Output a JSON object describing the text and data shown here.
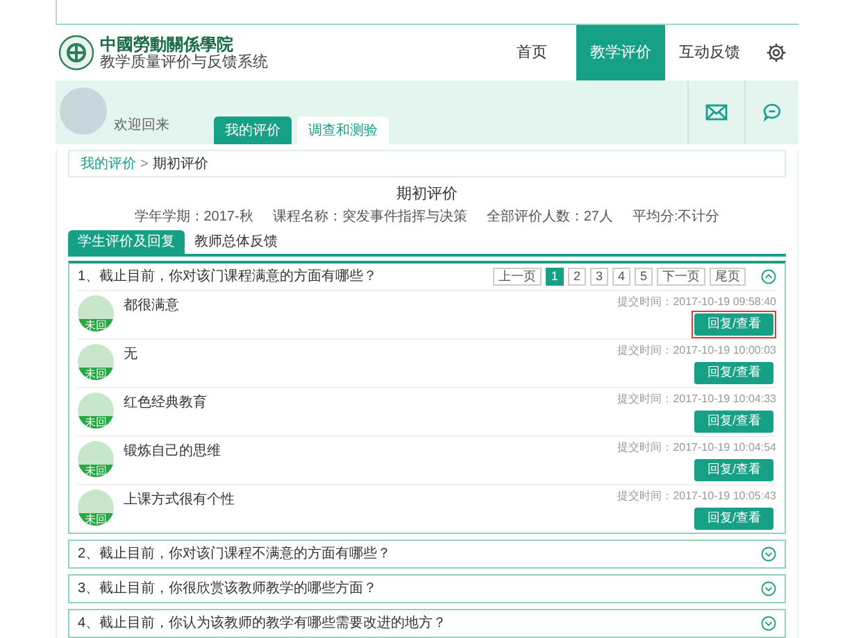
{
  "header": {
    "logo_title": "中國勞動關係學院",
    "logo_subtitle": "教学质量评价与反馈系统",
    "nav": [
      {
        "label": "首页",
        "selected": false
      },
      {
        "label": "教学评价",
        "selected": true
      },
      {
        "label": "互动反馈",
        "selected": false
      }
    ]
  },
  "profile": {
    "greeting": "欢迎回来",
    "tabs": [
      {
        "label": "我的评价",
        "selected": true
      },
      {
        "label": "调查和测验",
        "selected": false
      }
    ]
  },
  "breadcrumb": {
    "link": "我的评价",
    "separator": ">",
    "current": "期初评价"
  },
  "title": "期初评价",
  "info": [
    "学年学期：2017-秋",
    "课程名称：突发事件指挥与决策",
    "全部评价人数：27人",
    "平均分:不计分"
  ],
  "sub_tabs": [
    {
      "label": "学生评价及回复",
      "selected": true
    },
    {
      "label": "教师总体反馈",
      "selected": false
    }
  ],
  "questions": [
    {
      "text": "1、截止目前，你对该门课程满意的方面有哪些？",
      "expanded": true,
      "pagination": [
        {
          "label": "上一页",
          "selected": false
        },
        {
          "label": "1",
          "selected": true
        },
        {
          "label": "2",
          "selected": false
        },
        {
          "label": "3",
          "selected": false
        },
        {
          "label": "4",
          "selected": false
        },
        {
          "label": "5",
          "selected": false
        },
        {
          "label": "下一页",
          "selected": false
        },
        {
          "label": "尾页",
          "selected": false
        }
      ],
      "responses": [
        {
          "status": "未回",
          "text": "都很满意",
          "time": "提交时间：2017-10-19 09:58:40",
          "button": "回复/查看",
          "highlighted": true
        },
        {
          "status": "未回",
          "text": "无",
          "time": "提交时间：2017-10-19 10:00:03",
          "button": "回复/查看",
          "highlighted": false
        },
        {
          "status": "未回",
          "text": "红色经典教育",
          "time": "提交时间：2017-10-19 10:04:33",
          "button": "回复/查看",
          "highlighted": false
        },
        {
          "status": "未回",
          "text": "锻炼自己的思维",
          "time": "提交时间：2017-10-19 10:04:54",
          "button": "回复/查看",
          "highlighted": false
        },
        {
          "status": "未回",
          "text": "上课方式很有个性",
          "time": "提交时间：2017-10-19 10:05:43",
          "button": "回复/查看",
          "highlighted": false
        }
      ]
    },
    {
      "text": "2、截止目前，你对该门课程不满意的方面有哪些？",
      "expanded": false
    },
    {
      "text": "3、截止目前，你很欣赏该教师教学的哪些方面？",
      "expanded": false
    },
    {
      "text": "4、截止目前，你认为该教师的教学有哪些需要改进的地方？",
      "expanded": false
    }
  ]
}
